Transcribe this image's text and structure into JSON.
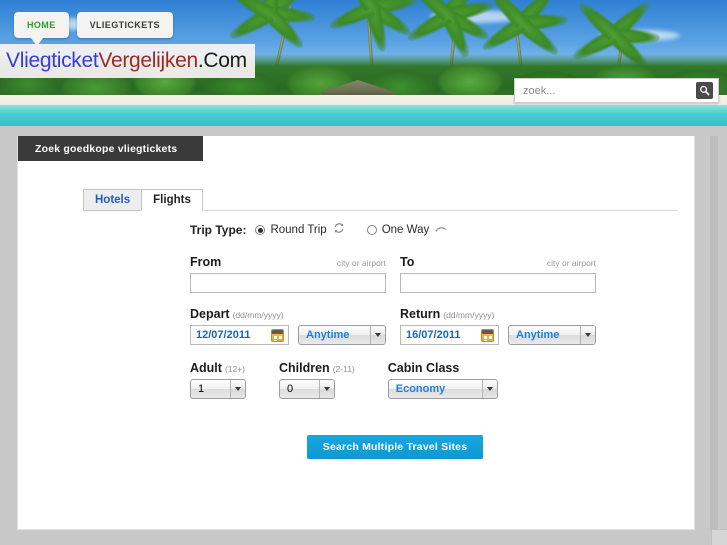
{
  "topnav": {
    "items": [
      {
        "label": "HOME",
        "active": true
      },
      {
        "label": "VLIEGTICKETS",
        "active": false
      }
    ]
  },
  "logo": {
    "part1": "Vliegticket",
    "part2": "Vergelijken",
    "part3": ".Com",
    "color1": "#3b3bd6",
    "color2": "#9c2a2a",
    "color3": "#1b1b1b"
  },
  "site_search": {
    "placeholder": "zoek...",
    "value": "",
    "icon": "search-icon"
  },
  "ribbon": {
    "title": "Zoek goedkope vliegtickets"
  },
  "tabs": [
    {
      "label": "Hotels",
      "active": false
    },
    {
      "label": "Flights",
      "active": true
    }
  ],
  "form": {
    "trip_type": {
      "label": "Trip Type:",
      "options": [
        {
          "label": "Round Trip",
          "selected": true,
          "icon": "round-trip-icon"
        },
        {
          "label": "One Way",
          "selected": false,
          "icon": "one-way-icon"
        }
      ]
    },
    "from": {
      "label": "From",
      "hint": "city or airport",
      "value": ""
    },
    "to": {
      "label": "To",
      "hint": "city or airport",
      "value": ""
    },
    "depart": {
      "label": "Depart",
      "format": "(dd/mm/yyyy)",
      "value": "12/07/2011",
      "time": "Anytime"
    },
    "return": {
      "label": "Return",
      "format": "(dd/mm/yyyy)",
      "value": "16/07/2011",
      "time": "Anytime"
    },
    "adult": {
      "label": "Adult",
      "sub": "(12+)",
      "value": "1"
    },
    "children": {
      "label": "Children",
      "sub": "(2-11)",
      "value": "0"
    },
    "cabin_class": {
      "label": "Cabin Class",
      "value": "Economy"
    },
    "submit": {
      "label": "Search Multiple Travel Sites",
      "color": "#0d9ad4"
    }
  }
}
